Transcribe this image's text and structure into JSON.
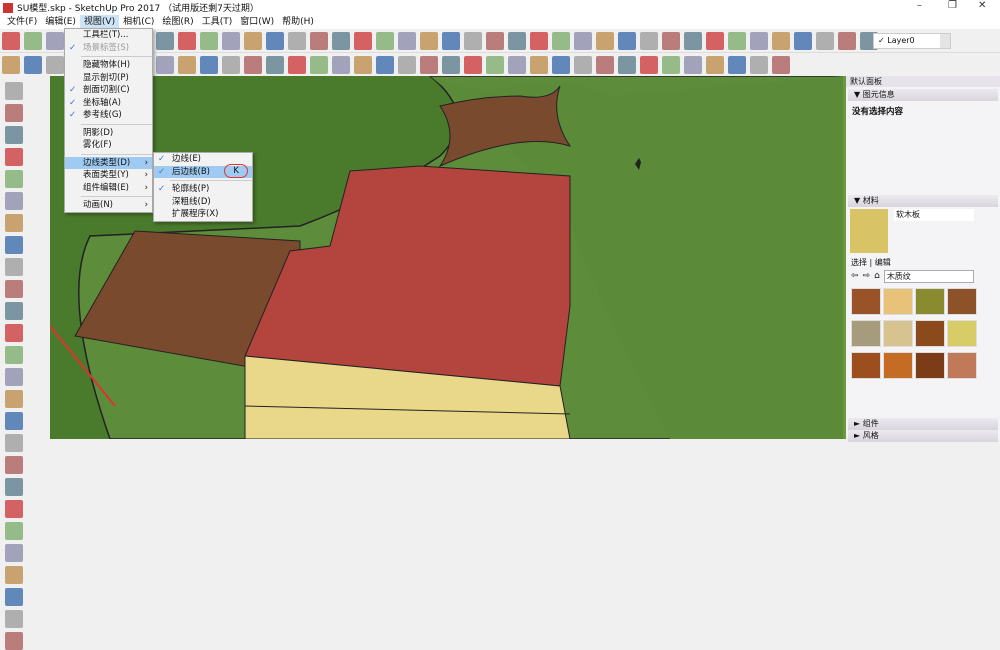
{
  "window": {
    "title": "SU模型.skp - SketchUp Pro 2017 （试用版还剩7天过期）",
    "minimize": "–",
    "maximize": "❐",
    "close": "✕"
  },
  "menubar": [
    "文件(F)",
    "编辑(E)",
    "视图(V)",
    "相机(C)",
    "绘图(R)",
    "工具(T)",
    "窗口(W)",
    "帮助(H)"
  ],
  "layer_select": {
    "value": "Layer0",
    "check": "✓"
  },
  "view_menu": {
    "items": [
      {
        "label": "工具栏(T)...",
        "checked": false
      },
      {
        "label": "场景标签(S)",
        "checked": true,
        "disabled": true
      },
      {
        "sep": true
      },
      {
        "label": "隐藏物体(H)"
      },
      {
        "label": "显示剖切(P)"
      },
      {
        "label": "剖面切割(C)",
        "checked": true
      },
      {
        "label": "坐标轴(A)",
        "checked": true
      },
      {
        "label": "参考线(G)",
        "checked": true
      },
      {
        "sep": true
      },
      {
        "label": "阴影(D)"
      },
      {
        "label": "雾化(F)"
      },
      {
        "sep": true
      },
      {
        "label": "边线类型(D)",
        "submenu": true,
        "highlighted": true
      },
      {
        "label": "表面类型(Y)",
        "submenu": true
      },
      {
        "label": "组件编辑(E)",
        "submenu": true
      },
      {
        "sep": true
      },
      {
        "label": "动画(N)",
        "submenu": true
      }
    ]
  },
  "edge_submenu": {
    "items": [
      {
        "label": "边线(E)",
        "checked": true
      },
      {
        "label": "后边线(B)",
        "checked": true,
        "highlighted": true,
        "shortcut": "K"
      },
      {
        "sep": true
      },
      {
        "label": "轮廓线(P)",
        "checked": true
      },
      {
        "label": "深粗线(D)"
      },
      {
        "label": "扩展程序(X)"
      }
    ]
  },
  "panel": {
    "title": "默认面板",
    "entity_info": {
      "header": "图元信息",
      "text": "没有选择内容"
    },
    "materials": {
      "header": "材料",
      "name": "软木板",
      "tab_select": "选择",
      "tab_edit": "编辑",
      "library": "木质纹",
      "swatches": [
        "#9a5328",
        "#e9c27a",
        "#8a8a2e",
        "#8e5228",
        "#a69b7a",
        "#d6c38f",
        "#8a4a1c",
        "#d8cc66",
        "#9c4e1e",
        "#c46c24",
        "#7c3c18",
        "#c07a5a"
      ]
    },
    "components": {
      "header": "组件"
    },
    "styles": {
      "header": "风格"
    }
  },
  "colors": {
    "grass": "#4a7a2c",
    "roof": "#b3443e",
    "wall": "#e9d88a",
    "wood": "#7a4a2e",
    "lawn": "#5d8d3a"
  }
}
